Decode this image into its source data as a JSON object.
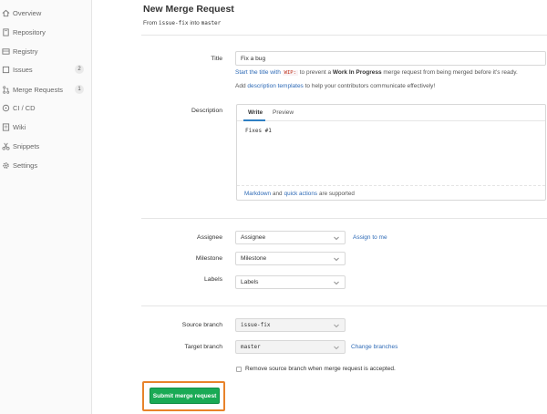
{
  "sidebar": {
    "items": [
      {
        "label": "Overview",
        "icon": "home-icon"
      },
      {
        "label": "Repository",
        "icon": "repository-icon"
      },
      {
        "label": "Registry",
        "icon": "registry-icon"
      },
      {
        "label": "Issues",
        "icon": "issues-icon",
        "badge": "2"
      },
      {
        "label": "Merge Requests",
        "icon": "merge-request-icon",
        "badge": "1"
      },
      {
        "label": "CI / CD",
        "icon": "ci-cd-icon"
      },
      {
        "label": "Wiki",
        "icon": "wiki-icon"
      },
      {
        "label": "Snippets",
        "icon": "snippets-icon"
      },
      {
        "label": "Settings",
        "icon": "settings-icon"
      }
    ]
  },
  "header": {
    "title": "New Merge Request",
    "from_prefix": "From",
    "source_branch": "issue-fix",
    "into_word": "into",
    "target_branch": "master"
  },
  "form": {
    "title_label": "Title",
    "title_value": "Fix a bug",
    "wip_help": {
      "link": "Start the title with",
      "code": "WIP:",
      "mid": "to prevent a",
      "bold": "Work In Progress",
      "rest": "merge request from being merged before it's ready."
    },
    "templates_help": {
      "prefix": "Add",
      "link": "description templates",
      "rest": "to help your contributors communicate effectively!"
    },
    "description_label": "Description",
    "tab_write": "Write",
    "tab_preview": "Preview",
    "description_value": "Fixes #1",
    "footer": {
      "markdown": "Markdown",
      "and": "and",
      "quick_actions": "quick actions",
      "rest": "are supported"
    },
    "assignee_label": "Assignee",
    "assignee_value": "Assignee",
    "assign_to_me": "Assign to me",
    "milestone_label": "Milestone",
    "milestone_value": "Milestone",
    "labels_label": "Labels",
    "labels_value": "Labels",
    "source_branch_label": "Source branch",
    "source_branch_value": "issue-fix",
    "target_branch_label": "Target branch",
    "target_branch_value": "master",
    "change_branches": "Change branches",
    "remove_source_branch": "Remove source branch when merge request is accepted.",
    "submit_label": "Submit merge request"
  },
  "colors": {
    "submit": "#1aaa55",
    "highlight_frame": "#e8832a",
    "link": "#2e6ab6"
  }
}
